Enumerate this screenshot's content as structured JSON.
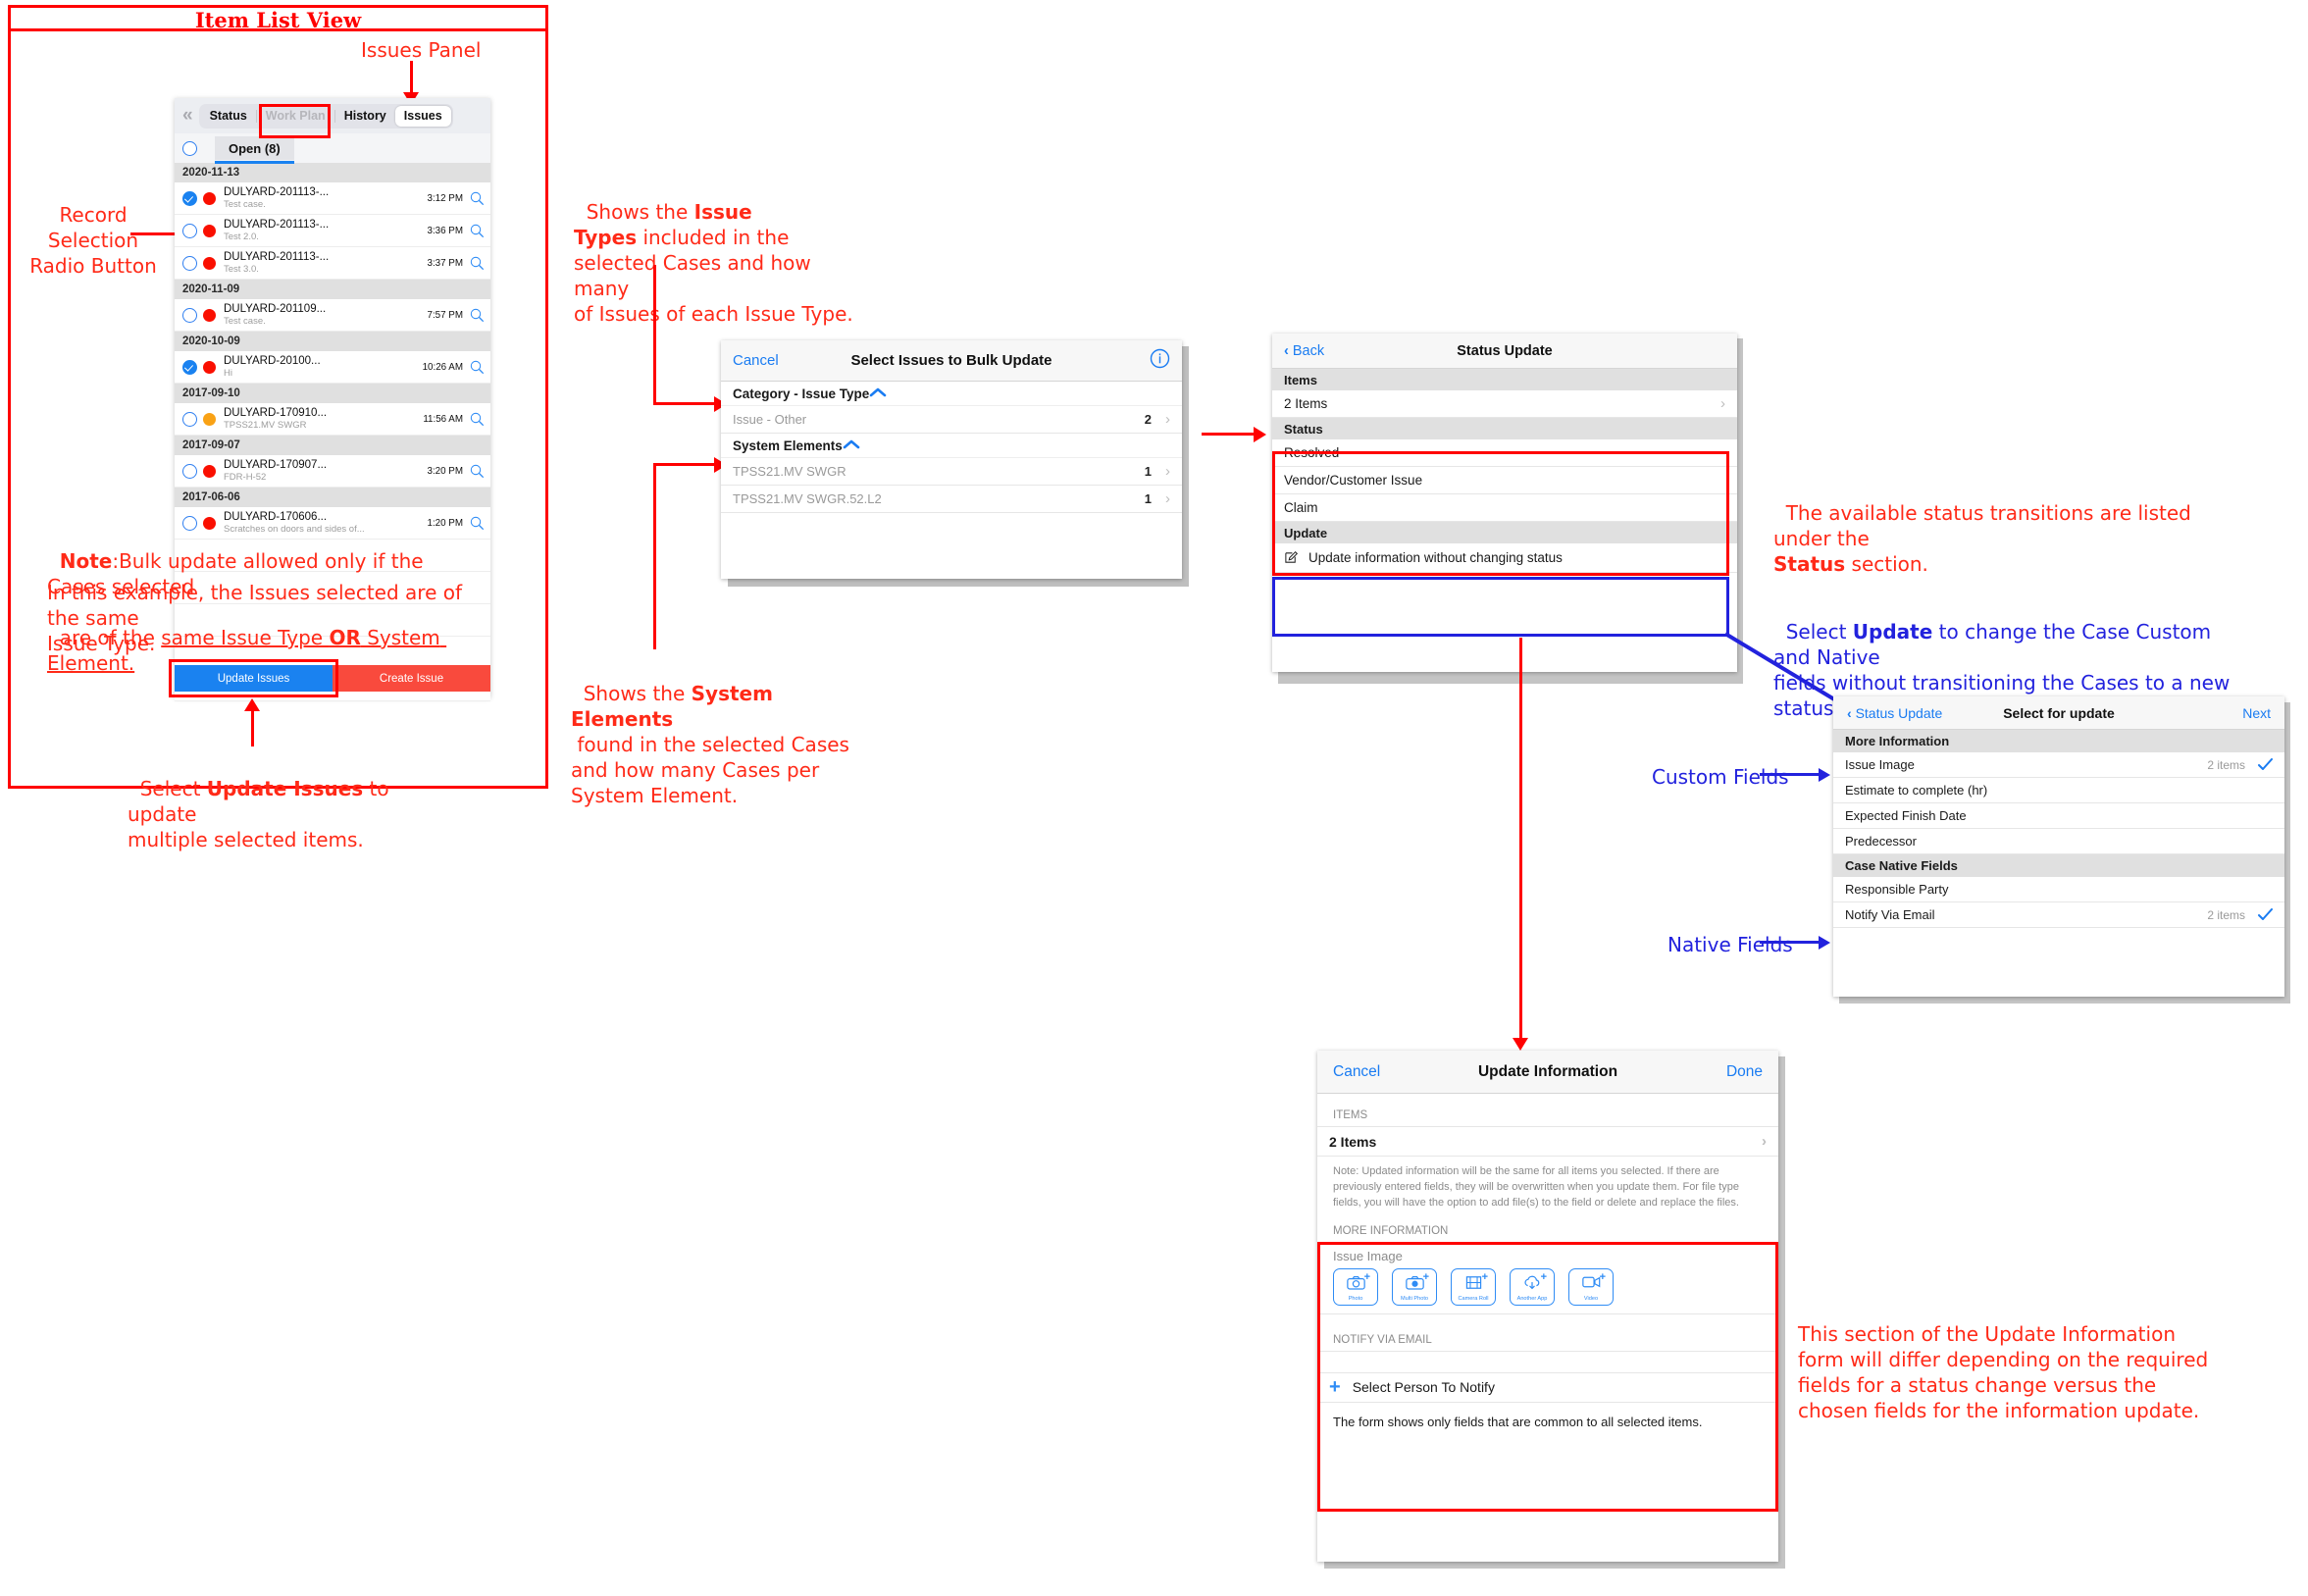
{
  "frames": {
    "item_list_view_title": "Item List View"
  },
  "annotations": {
    "issues_panel": "Issues Panel",
    "record_selection": "Record\nSelection\nRadio Button",
    "issue_types": {
      "pre": "Shows the ",
      "bold": "Issue\nTypes",
      "post": " included in the\nselected Cases and how many\nof Issues of each Issue Type."
    },
    "system_elements": {
      "pre": "Shows the ",
      "bold": "System Elements",
      "post": "\n found in the selected Cases\nand how many Cases per\nSystem Element."
    },
    "note": {
      "bold": "Note",
      "line1": ":Bulk update allowed only if the Cases selected",
      "line2_pre": "are of the ",
      "line2_u1": "same Issue Type ",
      "line2_b": "OR",
      "line2_u2": " System Element.",
      "line3": "In this example, the Issues selected are of the same\nIssue Type."
    },
    "update_issues_note": {
      "pre": "Select ",
      "bold": "Update Issues",
      "post": " to update\nmultiple selected items."
    },
    "status_transitions": {
      "pre": "The available status transitions are listed under the\n",
      "bold": "Status",
      "post": " section."
    },
    "select_update_note": {
      "pre": "Select ",
      "bold": "Update",
      "post": " to change the Case Custom and Native\nfields without transitioning the Cases to a new status."
    },
    "custom_fields": "Custom Fields",
    "native_fields": "Native Fields",
    "update_info_note": "This section of the Update Information\nform will differ depending on the required\nfields for a status change versus the\nchosen fields for the information update."
  },
  "item_list": {
    "collapse_icon": "double-chevron-left",
    "tabs": [
      {
        "label": "Status",
        "state": "normal"
      },
      {
        "label": "Work Plan",
        "state": "disabled"
      },
      {
        "label": "History",
        "state": "normal"
      },
      {
        "label": "Issues",
        "state": "selected"
      }
    ],
    "open_tab_label": "Open (8)",
    "select_all_radio": "unchecked",
    "groups": [
      {
        "date": "2020-11-13",
        "rows": [
          {
            "selected": true,
            "dot": "#fa0f00",
            "title": "DULYARD-201113-...",
            "subtitle": "Test case.",
            "time": "3:12 PM"
          },
          {
            "selected": false,
            "dot": "#fa0f00",
            "title": "DULYARD-201113-...",
            "subtitle": "Test 2.0.",
            "time": "3:36 PM"
          },
          {
            "selected": false,
            "dot": "#fa0f00",
            "title": "DULYARD-201113-...",
            "subtitle": "Test 3.0.",
            "time": "3:37 PM"
          }
        ]
      },
      {
        "date": "2020-11-09",
        "rows": [
          {
            "selected": false,
            "dot": "#fa0f00",
            "title": "DULYARD-201109...",
            "subtitle": "Test case.",
            "time": "7:57 PM"
          }
        ]
      },
      {
        "date": "2020-10-09",
        "rows": [
          {
            "selected": true,
            "dot": "#fa0f00",
            "title": "DULYARD-20100...",
            "subtitle": "Hi",
            "time": "10:26 AM"
          }
        ]
      },
      {
        "date": "2017-09-10",
        "rows": [
          {
            "selected": false,
            "dot": "#f9a215",
            "title": "DULYARD-170910...",
            "subtitle": "TPSS21.MV SWGR",
            "time": "11:56 AM"
          }
        ]
      },
      {
        "date": "2017-09-07",
        "rows": [
          {
            "selected": false,
            "dot": "#fa0f00",
            "title": "DULYARD-170907...",
            "subtitle": "FDR-H-52",
            "time": "3:20 PM"
          }
        ]
      },
      {
        "date": "2017-06-06",
        "rows": [
          {
            "selected": false,
            "dot": "#fa0f00",
            "title": "DULYARD-170606...",
            "subtitle": "Scratches on doors and sides of...",
            "time": "1:20 PM"
          }
        ]
      }
    ],
    "buttons": {
      "update": "Update Issues",
      "create": "Create Issue"
    }
  },
  "bulk_update": {
    "cancel": "Cancel",
    "title": "Select Issues to Bulk Update",
    "info_icon": "info-circle-icon",
    "sections": [
      {
        "header": "Category - Issue Type",
        "collapse": "chevron-up-icon",
        "rows": [
          {
            "label": "Issue - Other",
            "count": "2"
          }
        ]
      },
      {
        "header": "System Elements",
        "collapse": "chevron-up-icon",
        "rows": [
          {
            "label": "TPSS21.MV SWGR",
            "count": "1"
          },
          {
            "label": "TPSS21.MV SWGR.52.L2",
            "count": "1"
          }
        ]
      }
    ]
  },
  "status_update": {
    "back": "Back",
    "title": "Status Update",
    "items_header": "Items",
    "items_row": "2 Items",
    "status_header": "Status",
    "status_options": [
      "Resolved",
      "Vendor/Customer Issue",
      "Claim"
    ],
    "update_header": "Update",
    "update_row": "Update information without changing status",
    "update_row_icon": "edit-square-icon"
  },
  "select_for_update": {
    "back": "Status Update",
    "title": "Select for update",
    "next": "Next",
    "sections": [
      {
        "header": "More Information",
        "rows": [
          {
            "label": "Issue Image",
            "value": "2 items",
            "checked": true
          },
          {
            "label": "Estimate to complete (hr)",
            "value": "",
            "checked": false
          },
          {
            "label": "Expected Finish Date",
            "value": "",
            "checked": false
          },
          {
            "label": "Predecessor",
            "value": "",
            "checked": false
          }
        ]
      },
      {
        "header": "Case Native Fields",
        "rows": [
          {
            "label": "Responsible Party",
            "value": "",
            "checked": false
          },
          {
            "label": "Notify Via Email",
            "value": "2 items",
            "checked": true
          }
        ]
      }
    ]
  },
  "update_information": {
    "cancel": "Cancel",
    "title": "Update Information",
    "done": "Done",
    "items_header": "ITEMS",
    "items_row": "2 Items",
    "note": "Note: Updated information will be the same for all items you selected. If there are previously entered fields, they will be overwritten when you update them. For file type fields, you will have the option to add file(s) to the field or delete and replace the files.",
    "more_info_header": "MORE INFORMATION",
    "issue_image_label": "Issue Image",
    "media_buttons": [
      {
        "label": "Photo",
        "icon": "camera-icon"
      },
      {
        "label": "Multi Photo",
        "icon": "multi-camera-icon"
      },
      {
        "label": "Camera Roll",
        "icon": "film-strip-icon"
      },
      {
        "label": "Another App",
        "icon": "cloud-download-icon"
      },
      {
        "label": "Video",
        "icon": "video-camera-icon"
      }
    ],
    "notify_header": "NOTIFY VIA EMAIL",
    "select_person": "Select Person To Notify",
    "footer_note": "The form shows only fields that are common to all selected items."
  },
  "colors": {
    "accent_red": "#ff0000",
    "accent_blue": "#2222dd",
    "ios_blue": "#1a7cf2",
    "status_red": "#fa0f00",
    "status_orange": "#f9a215"
  }
}
